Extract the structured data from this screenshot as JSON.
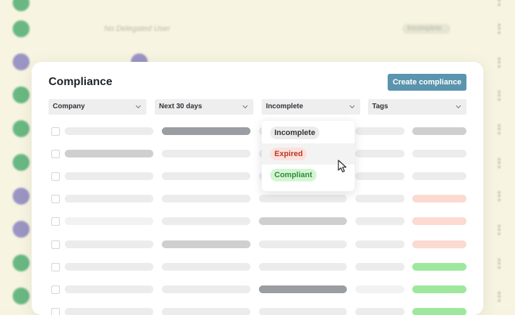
{
  "background": {
    "delegated_text": "No Delegated User",
    "status_text": "Incomplete",
    "avatar_colors": [
      "green",
      "green",
      "purple",
      "green",
      "green",
      "green",
      "green",
      "purple",
      "purple",
      "green",
      "green"
    ]
  },
  "page": {
    "title": "Compliance",
    "create_button": "Create compliance"
  },
  "filters": [
    {
      "label": "Company"
    },
    {
      "label": "Next 30 days"
    },
    {
      "label": "Incomplete"
    },
    {
      "label": "Tags"
    }
  ],
  "dropdown": {
    "options": [
      {
        "label": "Incomplete",
        "style": "incomplete"
      },
      {
        "label": "Expired",
        "style": "expired"
      },
      {
        "label": "Compliant",
        "style": "compliant"
      }
    ],
    "hovered_index": 1
  },
  "table_rows_count": 8,
  "colors": {
    "accent": "#5a94ae",
    "placeholder_light": "#ececec",
    "placeholder_mid": "#cfcfcf",
    "placeholder_dark": "#9a9da1",
    "status_red": "#fcd9d1",
    "status_green": "#9de89d"
  }
}
